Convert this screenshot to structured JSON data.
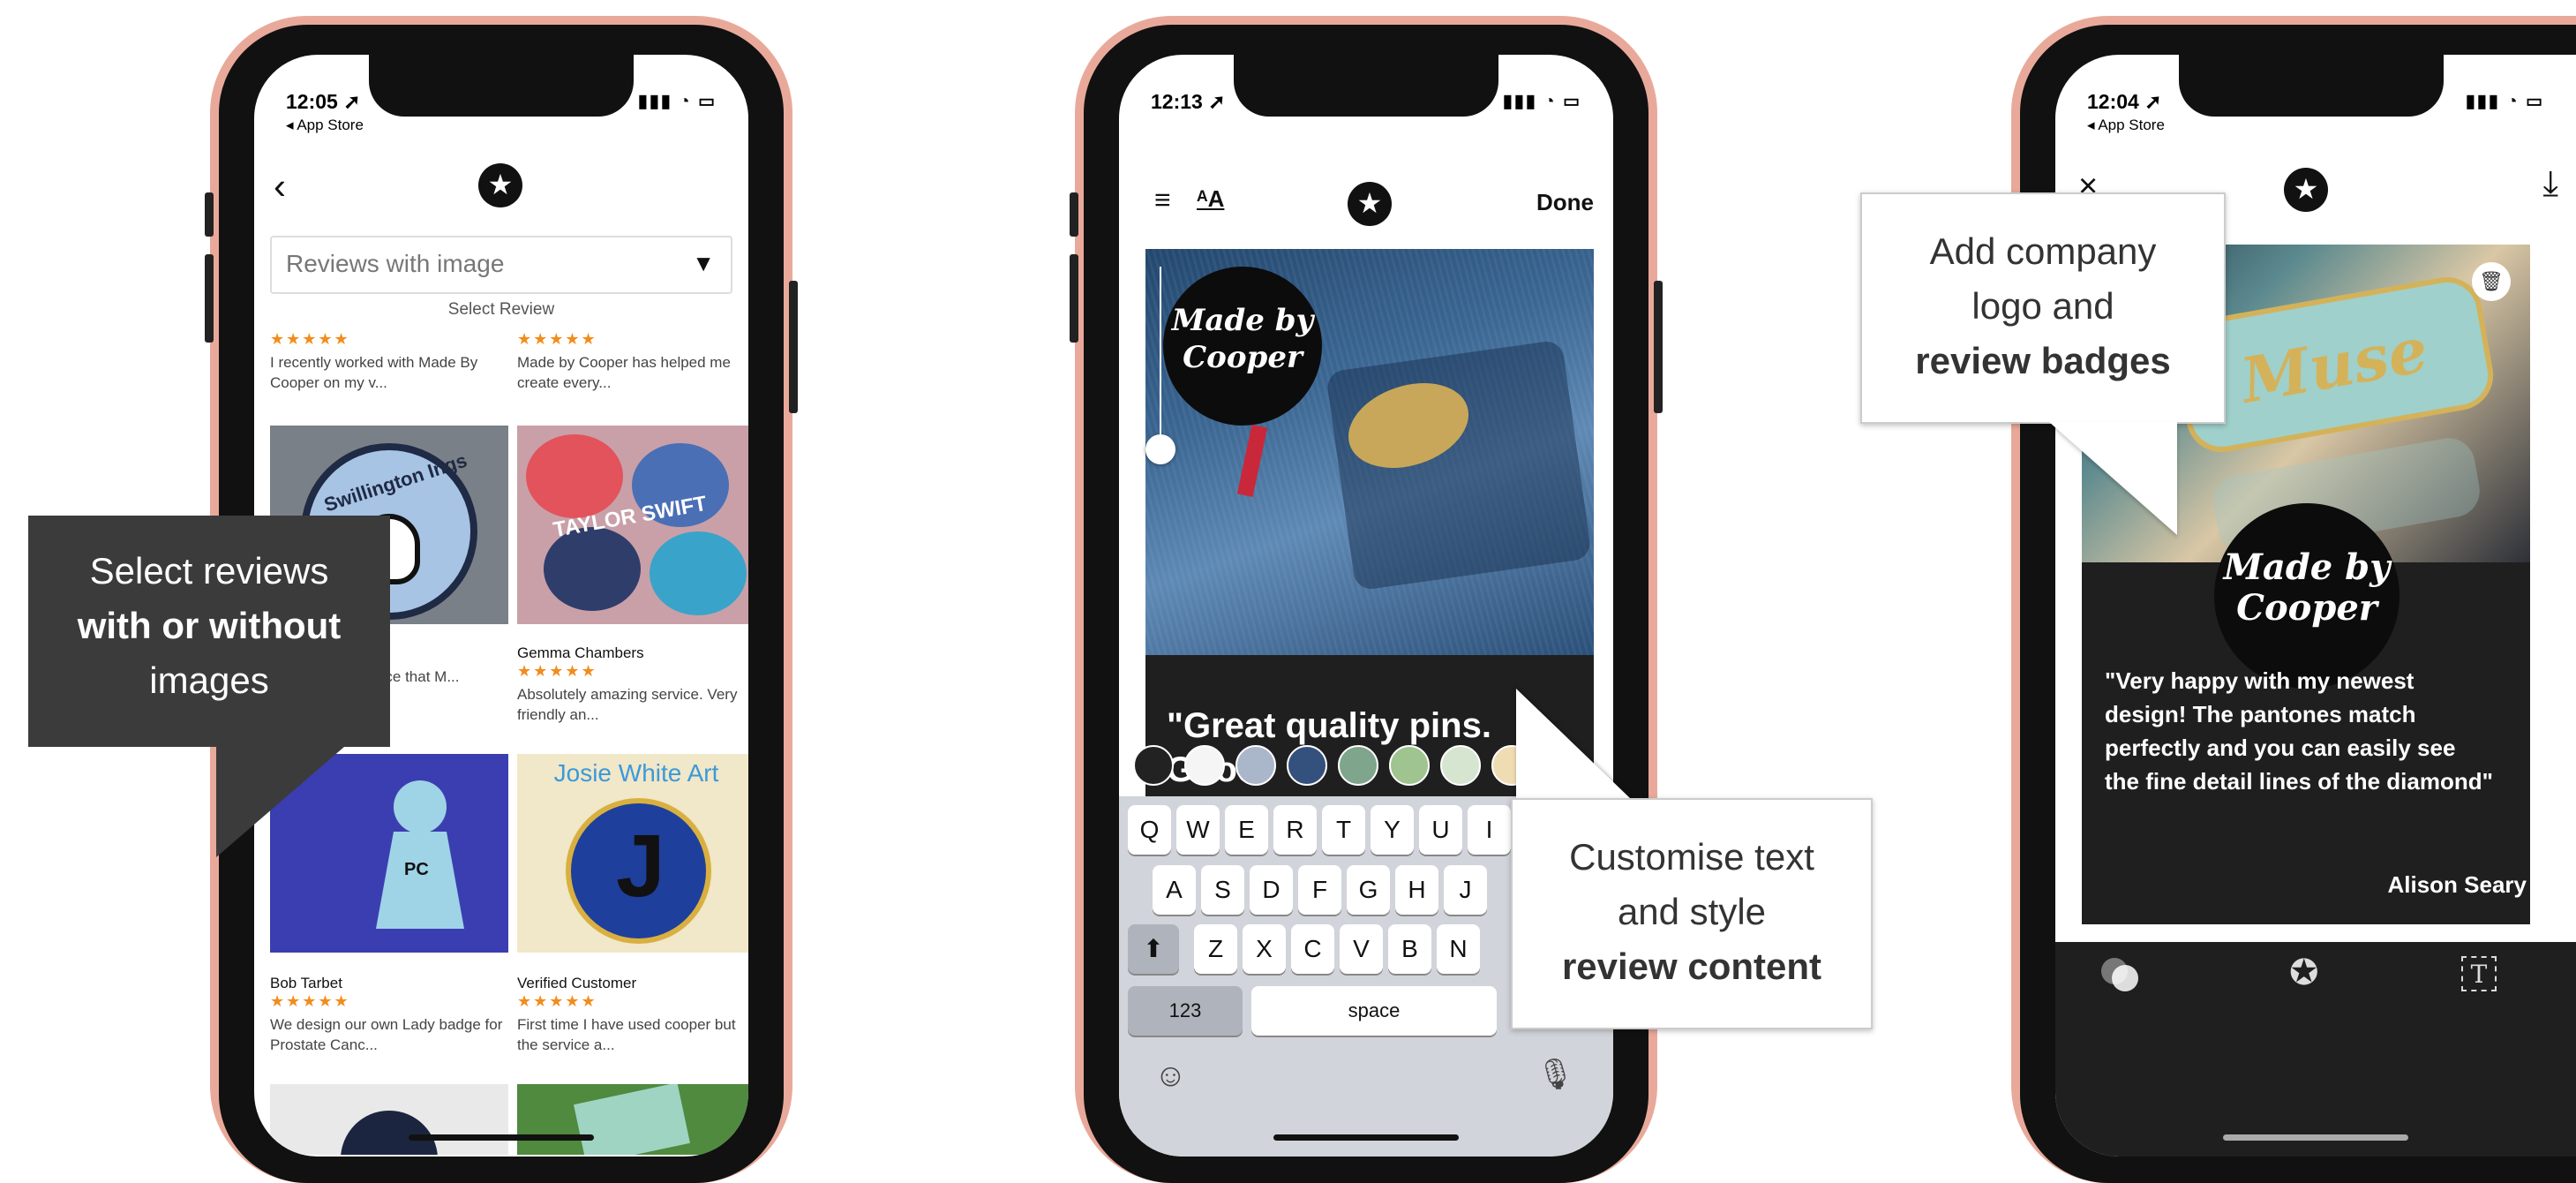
{
  "phone1": {
    "status_time": "12:05 ➚",
    "status_sub": "◂ App Store",
    "filter_value": "Reviews with image",
    "select_label": "Select Review",
    "reviews": [
      {
        "name": "",
        "stars": "★★★★★",
        "text": "I recently worked with Made By Cooper on my v..."
      },
      {
        "name": "",
        "stars": "★★★★★",
        "text": "Made by Cooper has helped me create every..."
      },
      {
        "name": "",
        "stars": "★★★★★",
        "text": "...to agreeing ...vice that M..."
      },
      {
        "name": "Gemma Chambers",
        "stars": "★★★★★",
        "text": "Absolutely amazing service. Very friendly an..."
      },
      {
        "name": "Bob Tarbet",
        "stars": "★★★★★",
        "text": "We design our own Lady badge for Prostate Canc..."
      },
      {
        "name": "Verified Customer",
        "stars": "★★★★★",
        "text": "First time I have used cooper but the service a..."
      }
    ],
    "thumb_texts": {
      "swillington": "Swillington Ings",
      "taylor": "TAYLOR SWIFT",
      "josie": "Josie White Art",
      "pc": "PC"
    }
  },
  "phone2": {
    "status_time": "12:13 ➚",
    "done_label": "Done",
    "quote_text": "\"Great quality pins. Good",
    "logo_text": "Made by Cooper",
    "swatch_colors": [
      "#222222",
      "#f5f5f5",
      "#aab6c9",
      "#34507d",
      "#7fa58c",
      "#9fc48f",
      "#d5e5cf",
      "#efdcb2"
    ],
    "keyboard_rows": [
      [
        "Q",
        "W",
        "E",
        "R",
        "T",
        "Y",
        "U",
        "I"
      ],
      [
        "A",
        "S",
        "D",
        "F",
        "G",
        "H",
        "J"
      ],
      [
        "Z",
        "X",
        "C",
        "V",
        "B",
        "N"
      ]
    ],
    "key_123": "123",
    "key_space": "space"
  },
  "phone3": {
    "status_time": "12:04 ➚",
    "status_sub": "◂ App Store",
    "logo_text": "Made by Cooper",
    "quote": "\"Very happy with my newest design! The pantones match perfectly and you can easily see the fine detail lines of the diamond\"",
    "author": "Alison Seary",
    "photo_text": "Muse"
  },
  "callouts": {
    "select": {
      "line1": "Select reviews",
      "bold": "with or without",
      "line3": "images"
    },
    "customise": {
      "line1": "Customise text",
      "line2": "and style",
      "bold": "review content"
    },
    "logo": {
      "line1": "Add company",
      "line2": "logo and",
      "bold": "review badges"
    }
  },
  "icons": [
    "back-icon",
    "star-icon",
    "caret-down-icon",
    "align-icon",
    "font-size-icon",
    "close-icon",
    "download-icon",
    "trash-icon",
    "shift-icon",
    "emoji-icon",
    "mic-icon",
    "color-circles-icon",
    "badge-icon",
    "text-box-icon"
  ]
}
